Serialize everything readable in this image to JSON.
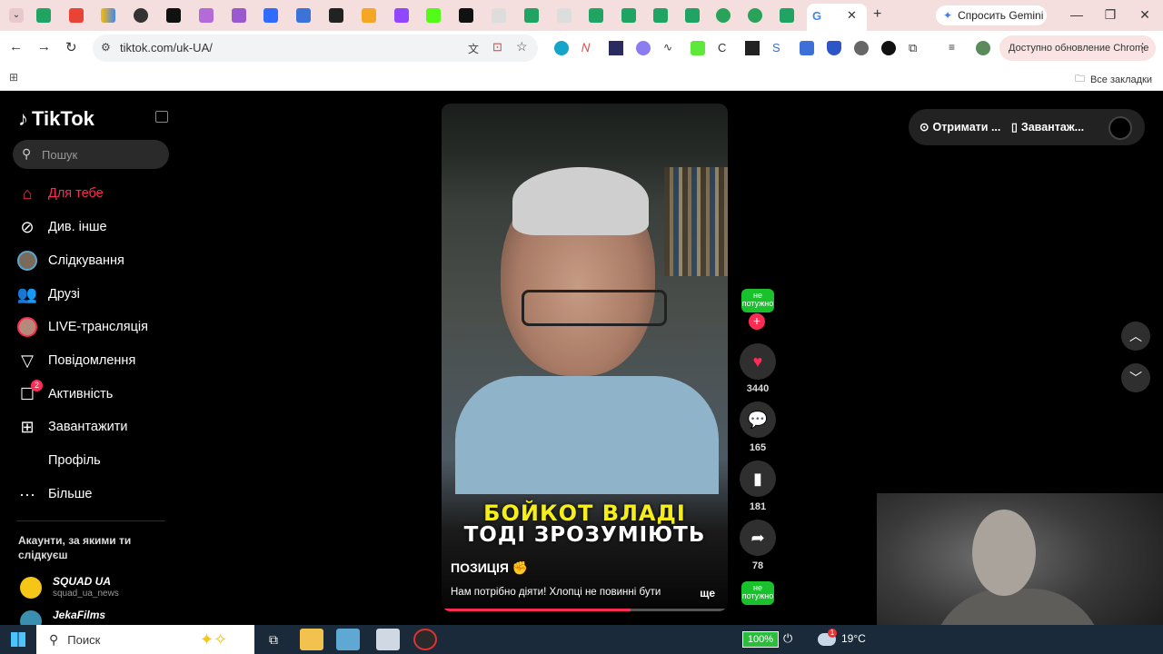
{
  "browser": {
    "gemini_label": "Спросить Gemini",
    "url": "tiktok.com/uk-UA/",
    "update_label": "Доступно обновление Chrome",
    "all_bookmarks": "Все закладки",
    "active_tab_favicon": "G"
  },
  "tiktok": {
    "logo_text": "TikTok",
    "search_placeholder": "Пошук",
    "nav": [
      {
        "label": "Для тебе",
        "icon": "home-icon"
      },
      {
        "label": "Див. інше",
        "icon": "compass-icon"
      },
      {
        "label": "Слідкування",
        "icon": "following-avatar-icon"
      },
      {
        "label": "Друзі",
        "icon": "friends-icon"
      },
      {
        "label": "LIVE-трансляція",
        "icon": "live-avatar-icon"
      },
      {
        "label": "Повідомлення",
        "icon": "messages-icon"
      },
      {
        "label": "Активність",
        "icon": "activity-icon",
        "badge": "2"
      },
      {
        "label": "Завантажити",
        "icon": "upload-icon"
      },
      {
        "label": "Профіль",
        "icon": ""
      },
      {
        "label": "Більше",
        "icon": "more-icon"
      }
    ],
    "accounts_heading": "Акаунти, за якими ти слідкуєш",
    "accounts": [
      {
        "name": "SQUAD UA",
        "handle": "squad_ua_news"
      },
      {
        "name": "JekaFilms",
        "handle": ""
      }
    ],
    "video": {
      "overlay_line1": "БОЙКОТ ВЛАДІ",
      "overlay_line2": "ТОДІ ЗРОЗУМІЮТЬ",
      "title": "ПОЗИЦІЯ ✊",
      "description": "Нам потрібно діяти! Хлопці не повинні бути",
      "more": "ще",
      "progress_percent": 66
    },
    "actions": {
      "creator_badge": "не потужно",
      "likes": "3440",
      "comments": "165",
      "saves": "181",
      "shares": "78"
    },
    "top_right": {
      "get_coins": "Отримати ...",
      "download_app": "Завантаж..."
    }
  },
  "taskbar": {
    "search_label": "Поиск",
    "battery": "100%",
    "weather": "19°C",
    "weather_badge": "1"
  }
}
